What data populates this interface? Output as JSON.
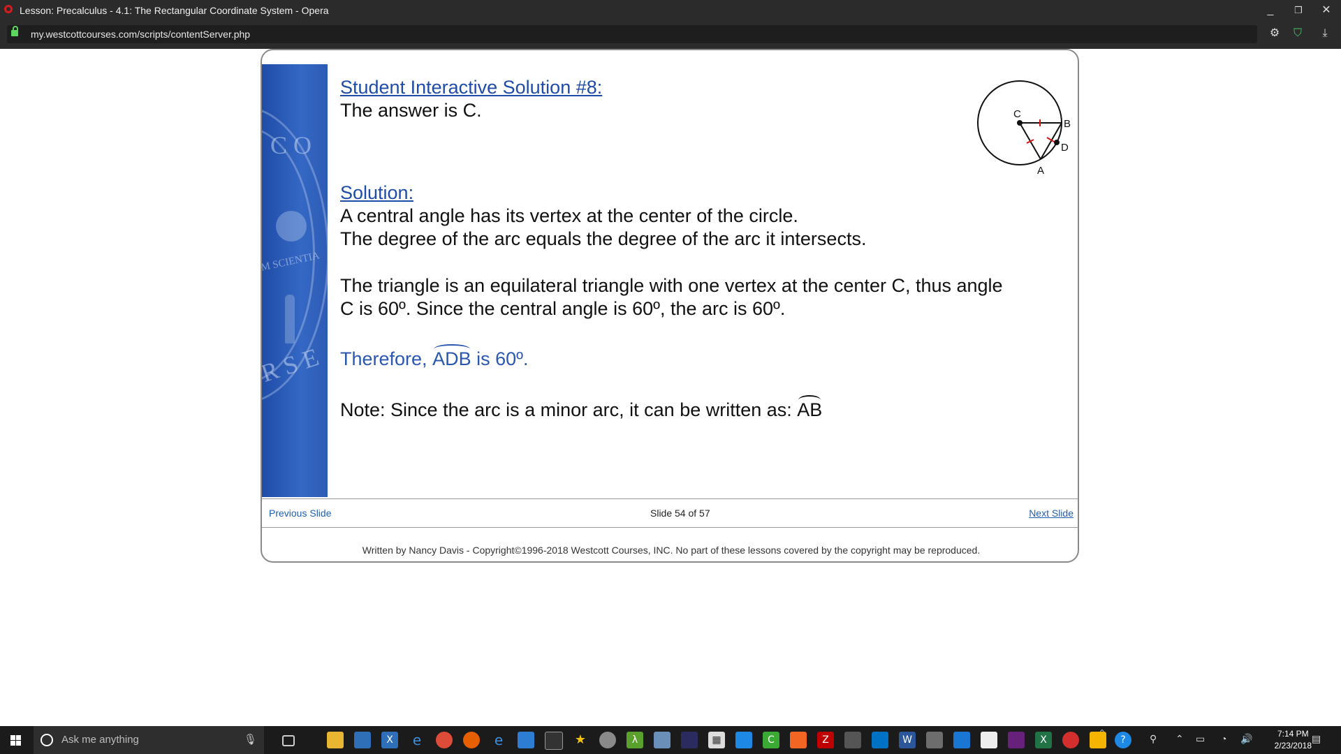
{
  "window": {
    "title": "Lesson: Precalculus - 4.1: The Rectangular Coordinate System - Opera",
    "minimize": "_",
    "restore": "❐",
    "close": "✕"
  },
  "address_bar": {
    "url": "my.westcottcourses.com/scripts/contentServer.php"
  },
  "sidebar": {
    "seal_text_top": "C O",
    "seal_text_mid": "M SCIENTIA",
    "seal_text_bottom": "R S E"
  },
  "lesson": {
    "heading": "Student Interactive Solution #8:",
    "answer": "The answer is C.",
    "solution_heading": "Solution:",
    "line1": "A central angle has its vertex at the center of the circle.",
    "line2": "The degree of the arc equals the degree of the arc it intersects.",
    "line3": "The triangle is an equilateral triangle with one vertex at the center C, thus angle",
    "line4": "C is 60º.  Since the central angle is 60º, the arc is 60º.",
    "therefore_prefix": "Therefore,",
    "therefore_arc": "ADB",
    "therefore_suffix": "is 60º.",
    "note_prefix": "Note:  Since the arc is a minor arc, it can be written as:",
    "note_arc": "AB"
  },
  "diagram": {
    "label_c": "C",
    "label_b": "B",
    "label_d": "D",
    "label_a": "A"
  },
  "navigation": {
    "previous": "Previous Slide",
    "slide_counter": "Slide 54 of 57",
    "next": "Next Slide"
  },
  "footer": {
    "copyright": "Written by Nancy Davis - Copyright©1996-2018 Westcott Courses, INC. No part of these lessons covered by the copyright may be reproduced."
  },
  "taskbar": {
    "search_placeholder": "Ask me anything",
    "time": "7:14 PM",
    "date": "2/23/2018"
  },
  "colors": {
    "sidebar_blue": "#2d5bb5",
    "heading_blue": "#1f4ca8",
    "link_blue": "#1f5fb0"
  }
}
